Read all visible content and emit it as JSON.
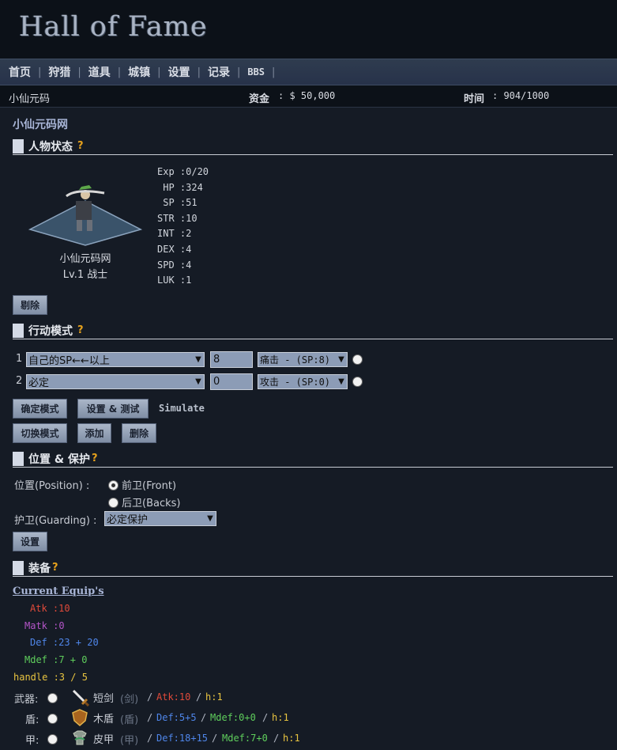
{
  "logo": "Hall of Fame",
  "nav": [
    "首页",
    "狩猎",
    "道具",
    "城镇",
    "设置",
    "记录",
    "BBS"
  ],
  "infobar": {
    "user": "小仙元码",
    "funds_label": "资金",
    "funds_value": ": $  50,000",
    "time_label": "时间",
    "time_value": ": 904/1000"
  },
  "site_name": "小仙元码网",
  "status": {
    "title": "人物状态",
    "help": "?",
    "char_name": "小仙元码网",
    "char_level": "Lv.1 战士",
    "stats": [
      "Exp :0/20",
      " HP :324",
      " SP :51",
      "STR :10",
      "INT :2",
      "DEX :4",
      "SPD :4",
      "LUK :1"
    ],
    "remove_button": "剔除"
  },
  "action": {
    "title": "行动模式",
    "help": "?",
    "rows": [
      {
        "num": "1",
        "condition": "自己的SP←←以上",
        "value": "8",
        "skill": "痛击 - (SP:8)"
      },
      {
        "num": "2",
        "condition": "必定",
        "value": "0",
        "skill": "攻击 - (SP:0)"
      }
    ],
    "confirm_button": "确定模式",
    "settest_button": "设置 & 测试",
    "simulate": "Simulate",
    "switch_button": "切换模式",
    "add_button": "添加",
    "delete_button": "删除"
  },
  "position": {
    "title": "位置 & 保护",
    "help": "?",
    "position_label": "位置(Position) :",
    "front": "前卫(Front)",
    "back": "后卫(Backs)",
    "guard_label": "护卫(Guarding) :",
    "guard_value": "必定保护",
    "set_button": "设置"
  },
  "equip": {
    "title": "装备",
    "help": "?",
    "current": "Current Equip's",
    "atk": "Atk :10",
    "matk": "Matk :0",
    "def": "Def :23 + 20",
    "mdef": "Mdef :7 + 0",
    "handle": "handle :3 / 5",
    "items": [
      {
        "slot": "武器:",
        "name": "短剑",
        "type": "(剑)",
        "s1": "Atk:10",
        "s2": "",
        "h": "h:1"
      },
      {
        "slot": "盾:",
        "name": "木盾",
        "type": "(盾)",
        "s1": "Def:5+5",
        "s2": "Mdef:0+0",
        "h": "h:1"
      },
      {
        "slot": "甲:",
        "name": "皮甲",
        "type": "(甲)",
        "s1": "Def:18+15",
        "s2": "Mdef:7+0",
        "h": "h:1"
      }
    ]
  },
  "colors": {
    "atk": "#e04a3a",
    "matk": "#b455c8",
    "def": "#4f86ea",
    "mdef": "#5fce5c",
    "handle": "#e8c440",
    "help": "#e6a11c"
  }
}
